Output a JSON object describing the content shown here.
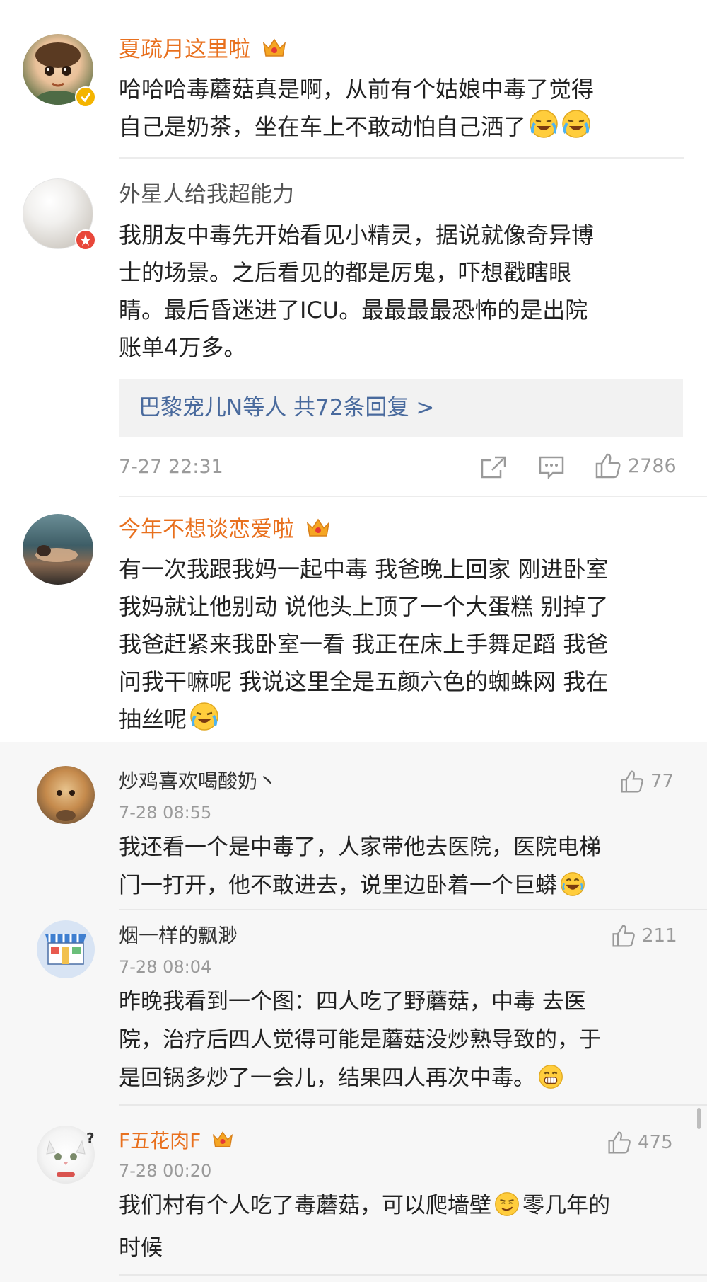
{
  "comments": [
    {
      "user": "夏疏月这里啦",
      "lines": [
        "哈哈哈毒蘑菇真是啊，从前有个姑娘中毒了觉得",
        "自己是奶茶，坐在车上不敢动怕自己洒了"
      ],
      "emoji": [
        "laugh-cry-emoji",
        "laugh-cry-emoji"
      ]
    },
    {
      "user": "外星人给我超能力",
      "lines": [
        "我朋友中毒先开始看见小精灵，据说就像奇异博",
        "士的场景。之后看见的都是厉鬼，吓想戳瞎眼",
        "睛。最后昏迷进了ICU。最最最最恐怖的是出院",
        "账单4万多。"
      ],
      "reply_summary": "巴黎宠儿N等人 共72条回复 >",
      "time": "7-27 22:31",
      "likes": "2786"
    },
    {
      "user": "今年不想谈恋爱啦",
      "lines": [
        "有一次我跟我妈一起中毒 我爸晚上回家 刚进卧室",
        "我妈就让他别动 说他头上顶了一个大蛋糕 别掉了",
        "我爸赶紧来我卧室一看 我正在床上手舞足蹈 我爸",
        "问我干嘛呢 我说这里全是五颜六色的蜘蛛网 我在",
        "抽丝呢"
      ]
    }
  ],
  "sub_comments": [
    {
      "user": "炒鸡喜欢喝酸奶丶",
      "time": "7-28 08:55",
      "likes": "77",
      "lines": [
        "我还看一个是中毒了，人家带他去医院，医院电梯",
        "门一打开，他不敢进去，说里边卧着一个巨蟒"
      ]
    },
    {
      "user": "烟一样的飘渺",
      "time": "7-28 08:04",
      "likes": "211",
      "lines": [
        "昨晚我看到一个图：四人吃了野蘑菇，中毒 去医",
        "院，治疗后四人觉得可能是蘑菇没炒熟导致的，于",
        "是回锅多炒了一会儿，结果四人再次中毒。"
      ]
    },
    {
      "user": "F五花肉F",
      "time": "7-28 00:20",
      "likes": "475",
      "lines": [
        "我们村有个人吃了毒蘑菇，可以爬墙壁",
        "时候"
      ],
      "line1_suffix": "零几年的"
    }
  ],
  "colors": {
    "username_vip": "#e8701e",
    "link": "#496a9d",
    "meta": "#9a9a9a",
    "reply_bg": "#f2f2f2"
  }
}
